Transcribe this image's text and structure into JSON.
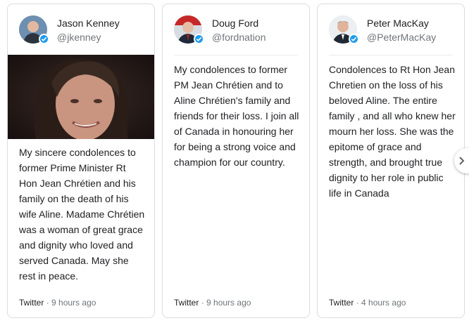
{
  "colors": {
    "accent": "#1d9bf0",
    "muted": "#70757a",
    "text": "#202124",
    "border": "#dadce0"
  },
  "tweets": [
    {
      "name": "Jason Kenney",
      "handle": "@jkenney",
      "has_photo": true,
      "text": "My sincere condolences to former Prime Minister Rt Hon Jean Chrétien and his family on the death of his wife Aline. Madame Chrétien was a woman of great grace and dignity who loved and served Canada. May she rest in peace.",
      "source": "Twitter",
      "separator": "·",
      "time": "9 hours ago"
    },
    {
      "name": "Doug Ford",
      "handle": "@fordnation",
      "has_photo": false,
      "text": "My condolences to former PM Jean Chrétien and to Aline Chrétien's family and friends for their loss. I join all of Canada in honouring her for being a strong voice and champion for our country.",
      "source": "Twitter",
      "separator": "·",
      "time": "9 hours ago"
    },
    {
      "name": "Peter MacKay",
      "handle": "@PeterMacKay",
      "has_photo": false,
      "text": "Condolences to Rt Hon Jean Chretien on the loss of his beloved Aline. The entire family , and all who knew her mourn her loss. She was the epitome of grace and strength, and brought true dignity to her role in public life in Canada",
      "source": "Twitter",
      "separator": "·",
      "time": "4 hours ago"
    }
  ],
  "icons": {
    "verified": "verified-badge-icon",
    "next": "chevron-right-icon"
  }
}
